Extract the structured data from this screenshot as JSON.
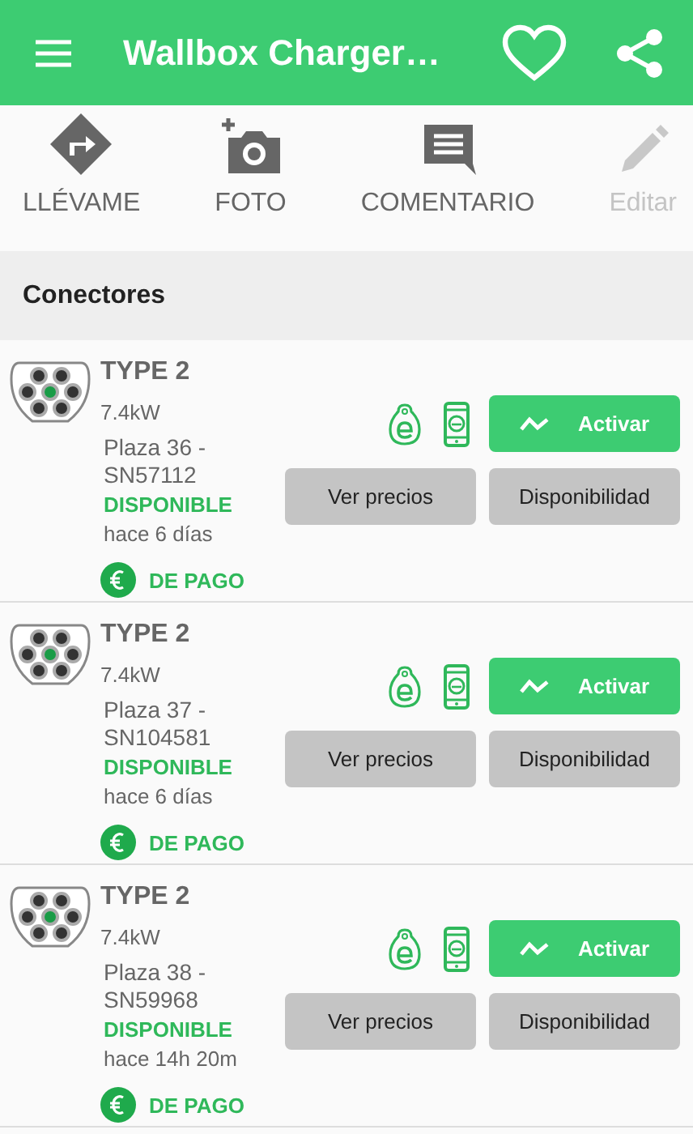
{
  "app_bar": {
    "title": "Wallbox Charger…"
  },
  "actions": [
    {
      "kind": "directions",
      "label": "LLÉVAME",
      "disabled": false
    },
    {
      "kind": "photo",
      "label": "FOTO",
      "disabled": false
    },
    {
      "kind": "comment",
      "label": "COMENTARIO",
      "disabled": false
    },
    {
      "kind": "edit",
      "label": "Editar",
      "disabled": true
    }
  ],
  "section": {
    "title": "Conectores"
  },
  "connectors": [
    {
      "type": "TYPE 2",
      "power": "7.4kW",
      "location": "Plaza 36 - SN57112",
      "status": "DISPONIBLE",
      "updated": "hace 6 días",
      "payment": "DE PAGO",
      "activate": "Activar",
      "prices": "Ver precios",
      "availability": "Disponibilidad"
    },
    {
      "type": "TYPE 2",
      "power": "7.4kW",
      "location": "Plaza 37 - SN104581",
      "status": "DISPONIBLE",
      "updated": "hace 6 días",
      "payment": "DE PAGO",
      "activate": "Activar",
      "prices": "Ver precios",
      "availability": "Disponibilidad"
    },
    {
      "type": "TYPE 2",
      "power": "7.4kW",
      "location": "Plaza 38 - SN59968",
      "status": "DISPONIBLE",
      "updated": "hace 14h 20m",
      "payment": "DE PAGO",
      "activate": "Activar",
      "prices": "Ver precios",
      "availability": "Disponibilidad"
    }
  ]
}
